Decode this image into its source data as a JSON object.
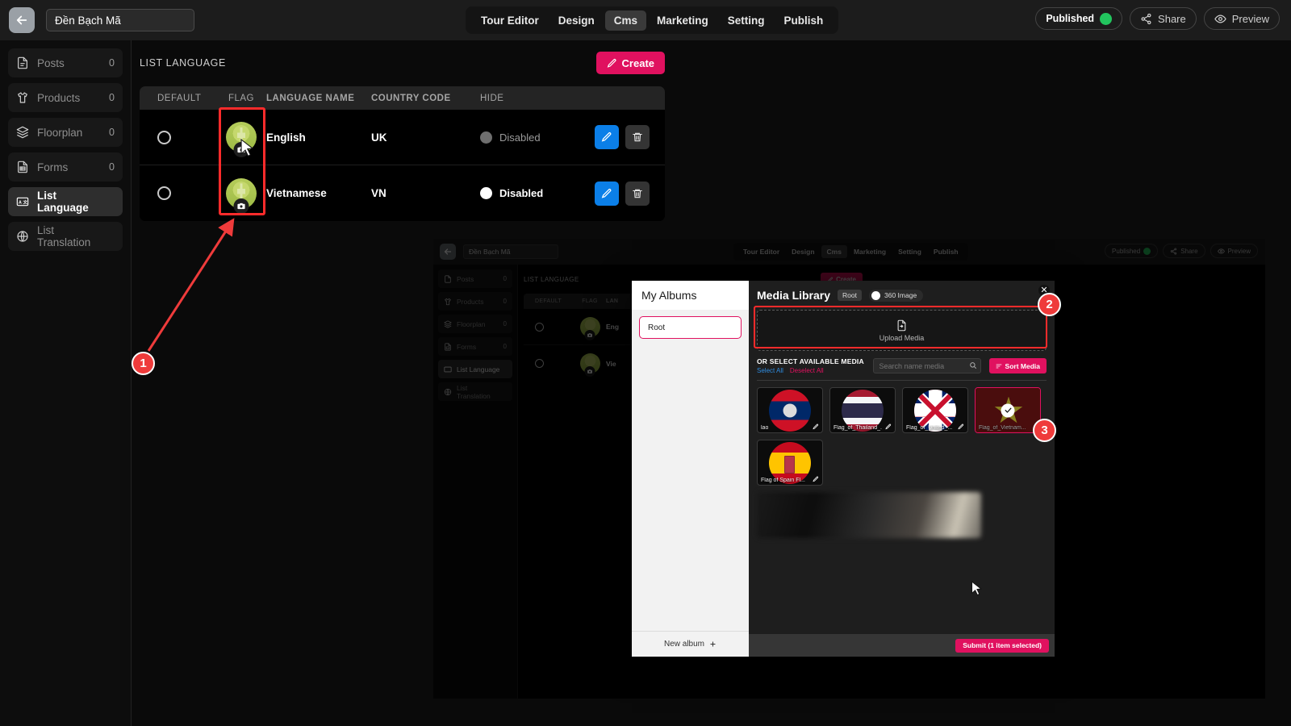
{
  "topbar": {
    "back_icon": "arrow-left-icon",
    "project_title": "Đền Bạch Mã",
    "tabs": [
      {
        "label": "Tour Editor",
        "active": false
      },
      {
        "label": "Design",
        "active": false
      },
      {
        "label": "Cms",
        "active": true
      },
      {
        "label": "Marketing",
        "active": false
      },
      {
        "label": "Setting",
        "active": false
      },
      {
        "label": "Publish",
        "active": false
      }
    ],
    "published_label": "Published",
    "share_label": "Share",
    "preview_label": "Preview",
    "accent_green": "#22c55e"
  },
  "sidebar": {
    "items": [
      {
        "label": "Posts",
        "count": "0",
        "icon": "document-icon",
        "active": false
      },
      {
        "label": "Products",
        "count": "0",
        "icon": "tshirt-icon",
        "active": false
      },
      {
        "label": "Floorplan",
        "count": "0",
        "icon": "layers-icon",
        "active": false
      },
      {
        "label": "Forms",
        "count": "0",
        "icon": "form-icon",
        "active": false
      },
      {
        "label": "List Language",
        "count": "",
        "icon": "language-icon",
        "active": true
      },
      {
        "label": "List Translation",
        "count": "",
        "icon": "globe-icon",
        "active": false
      }
    ]
  },
  "main": {
    "panel_title": "LIST LANGUAGE",
    "create_label": "Create",
    "columns": [
      "DEFAULT",
      "FLAG",
      "LANGUAGE NAME",
      "COUNTRY CODE",
      "HIDE"
    ],
    "rows": [
      {
        "language": "English",
        "code": "UK",
        "hide_label": "Disabled",
        "hide_color": "#6e6e6e",
        "hide_text_color": "#9a9a9a"
      },
      {
        "language": "Vietnamese",
        "code": "VN",
        "hide_label": "Disabled",
        "hide_color": "#ffffff",
        "hide_text_color": "#ffffff"
      }
    ],
    "edit_icon": "pencil-icon",
    "delete_icon": "trash-icon"
  },
  "annotations": [
    {
      "number": "1",
      "target": "flag-column-cells"
    },
    {
      "number": "2",
      "target": "upload-media-dropzone"
    },
    {
      "number": "3",
      "target": "selected-media-tile"
    }
  ],
  "modal": {
    "albums_title": "My Albums",
    "album_items": [
      "Root"
    ],
    "new_album_label": "New album",
    "library_title": "Media Library",
    "root_badge": "Root",
    "toggle_360_label": "360 Image",
    "upload_label": "Upload Media",
    "select_media_title": "OR SELECT AVAILABLE MEDIA",
    "select_all_label": "Select All",
    "deselect_all_label": "Deselect All",
    "search_placeholder": "Search name media",
    "sort_label": "Sort Media",
    "submit_label": "Submit (1 item selected)",
    "close_icon": "close-icon",
    "accent_pink": "#e0115f",
    "media": [
      {
        "name": "lao",
        "flag": "f-lao",
        "selected": false
      },
      {
        "name": "Flag_of_Thailand_...",
        "flag": "f-thai",
        "selected": false
      },
      {
        "name": "Flag_of_United_...",
        "flag": "f-uk",
        "selected": false
      },
      {
        "name": "Flag_of_Vietnam...",
        "flag": "f-vn",
        "selected": true
      },
      {
        "name": "Flag of Spain Fl...",
        "flag": "f-es",
        "selected": false
      }
    ]
  },
  "overlay": {
    "project_title": "Đền Bạch Mã",
    "tabs": [
      "Tour Editor",
      "Design",
      "Cms",
      "Marketing",
      "Setting",
      "Publish"
    ],
    "published_label": "Published",
    "share_label": "Share",
    "preview_label": "Preview",
    "sidebar_items": [
      {
        "label": "Posts",
        "count": "0"
      },
      {
        "label": "Products",
        "count": "0"
      },
      {
        "label": "Floorplan",
        "count": "0"
      },
      {
        "label": "Forms",
        "count": "0"
      },
      {
        "label": "List Language",
        "count": ""
      },
      {
        "label": "List Translation",
        "count": ""
      }
    ],
    "panel_title": "LIST LANGUAGE",
    "create_label": "Create",
    "columns": [
      "DEFAULT",
      "FLAG",
      "LAN"
    ],
    "rows": [
      {
        "language": "Eng"
      },
      {
        "language": "Vie"
      }
    ]
  }
}
